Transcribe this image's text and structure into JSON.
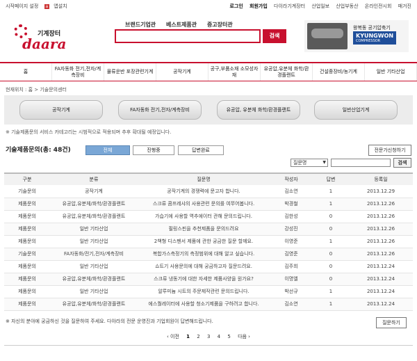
{
  "util": {
    "left": [
      "시작페이지 설정",
      "앱설치"
    ],
    "right": [
      "로그인",
      "회원가입",
      "다이라기계장터",
      "산업일보",
      "산업부동산",
      "온라인전시회",
      "매거진"
    ]
  },
  "logo": {
    "small": "기계장터",
    "big": "daara"
  },
  "search": {
    "links": [
      "브랜드기업관",
      "베스트제품관",
      "중고장터관"
    ],
    "button": "검색"
  },
  "banner": {
    "caption": "왕복동 공기압축기",
    "brand": "KYUNGWON",
    "brand_sub": "COMPRESSOR"
  },
  "nav": [
    "홈",
    "FA자동화 전기,전자/계측장비",
    "물류운반 포장관련기계",
    "공작기계",
    "공구,부품소재 소모성자재",
    "유공압,유분체 화학/환경플랜트",
    "건설중장비/농기계",
    "일반 기타산업"
  ],
  "breadcrumb": "현재위치 : 홈 > 기술문의센터",
  "categories": [
    "공작기계",
    "FA자동화 전기,전자/계측장비",
    "유공압, 유분체 화학/환경플랜트",
    "일반산업기계"
  ],
  "notice": "※ 기술제품문의 서비스 카테고리는 시범적으로 적용되며 추후 확대될 예정입니다.",
  "list": {
    "title": "기술제품문의(총: 48건)",
    "tabs": [
      "전체",
      "진행중",
      "답변완료"
    ],
    "request_button": "전문가신청하기",
    "search_select": "질문명",
    "search_button": "검색",
    "columns": [
      "구분",
      "분류",
      "질문명",
      "작성자",
      "답변",
      "등록일"
    ],
    "rows": [
      [
        "기술문의",
        "공작기계",
        "공작기계의 경쟁력에 문고자 합니다.",
        "김소연",
        "1",
        "2013.12.29"
      ],
      [
        "제품문의",
        "유공압,유분체/화학/환경플랜트",
        "스크류 콤프레샤의 사용관련 문의를 여쭈어봅니다.",
        "박경철",
        "1",
        "2013.12.26"
      ],
      [
        "제품문의",
        "유공압,유분체/화학/환경플랜트",
        "가습기에 사용할 역추에이터 관해 문의드립니다.",
        "김한성",
        "0",
        "2013.12.26"
      ],
      [
        "제품문의",
        "일반 기타산업",
        "필링스핀을 추천제품을 문의드려요",
        "강성진",
        "0",
        "2013.12.26"
      ],
      [
        "제품문의",
        "일반 기타산업",
        "2책형 디스펜서 제품에 관한 궁금한 질문 할께요.",
        "이영준",
        "1",
        "2013.12.26"
      ],
      [
        "기술문의",
        "FA자동화/전기,전자/계측장비",
        "복합가스측정기의 측정범위에 대해 알고 싶습니다.",
        "김영준",
        "0",
        "2013.12.26"
      ],
      [
        "제품문의",
        "일반 기타산업",
        "쇼트기 사용문의에 대해 궁금하고자 질문드려요.",
        "김주희",
        "0",
        "2013.12.24"
      ],
      [
        "제품문의",
        "유공압,유분체/화학/환경플랜트",
        "스크류 냉동기에 대한 자세한 제품사양을 원가요?",
        "이명엘",
        "0",
        "2013.12.24"
      ],
      [
        "제품문의",
        "일반 기타산업",
        "알루미늄 시트의 주문제작관련 문의드립니다.",
        "박선규",
        "1",
        "2013.12.24"
      ],
      [
        "제품문의",
        "유공압,유분체/화학/환경플랜트",
        "에스퀄레이터에 사용할 청소기제품을 구하려고 합니다.",
        "김소연",
        "1",
        "2013.12.24"
      ]
    ]
  },
  "footer_note": "※ 자신의 분야에 궁금하신 것을 질문하여 주세요. 다아라의 전문 운영진과 기업회원이 답변해드립니다.",
  "ask_button": "질문하기",
  "pager": {
    "prev": "‹ 이전",
    "pages": [
      "1",
      "2",
      "3",
      "4",
      "5"
    ],
    "current": "1",
    "next": "다음 ›"
  }
}
